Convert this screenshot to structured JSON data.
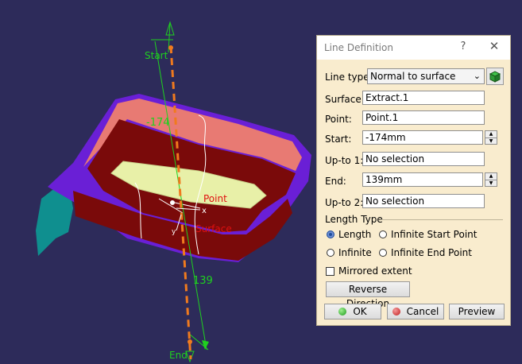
{
  "viewport": {
    "start_label": "Start",
    "end_label": "End",
    "start_value": "-174",
    "end_value": "139",
    "point_label": "Point",
    "surface_label": "Surface",
    "axis_x": "x",
    "axis_y": "y"
  },
  "dialog": {
    "title": "Line Definition",
    "help": "?",
    "close": "✕",
    "line_type_label": "Line type :",
    "line_type_value": "Normal to surface",
    "surface_label": "Surface:",
    "surface_value": "Extract.1",
    "point_label": "Point:",
    "point_value": "Point.1",
    "start_label": "Start:",
    "start_value": "-174mm",
    "upto1_label": "Up-to 1:",
    "upto1_value": "No selection",
    "end_label": "End:",
    "end_value": "139mm",
    "upto2_label": "Up-to 2:",
    "upto2_value": "No selection",
    "length_type_label": "Length Type",
    "length_option": "Length",
    "infinite_start_option": "Infinite Start Point",
    "infinite_option": "Infinite",
    "infinite_end_option": "Infinite End Point",
    "mirrored_label": "Mirrored extent",
    "reverse_label": "Reverse Direction",
    "ok_label": "OK",
    "cancel_label": "Cancel",
    "preview_label": "Preview"
  },
  "colors": {
    "background": "#2d2b5a",
    "part_purple": "#6a1fd6",
    "part_red": "#7a0a0a",
    "part_salmon": "#e87a73",
    "part_yellow": "#e8f0a8",
    "teal": "#0f8f8f",
    "guide_green": "#1fd11f",
    "dash_orange": "#f07a1e",
    "dialog_bg": "#f9ecce"
  }
}
